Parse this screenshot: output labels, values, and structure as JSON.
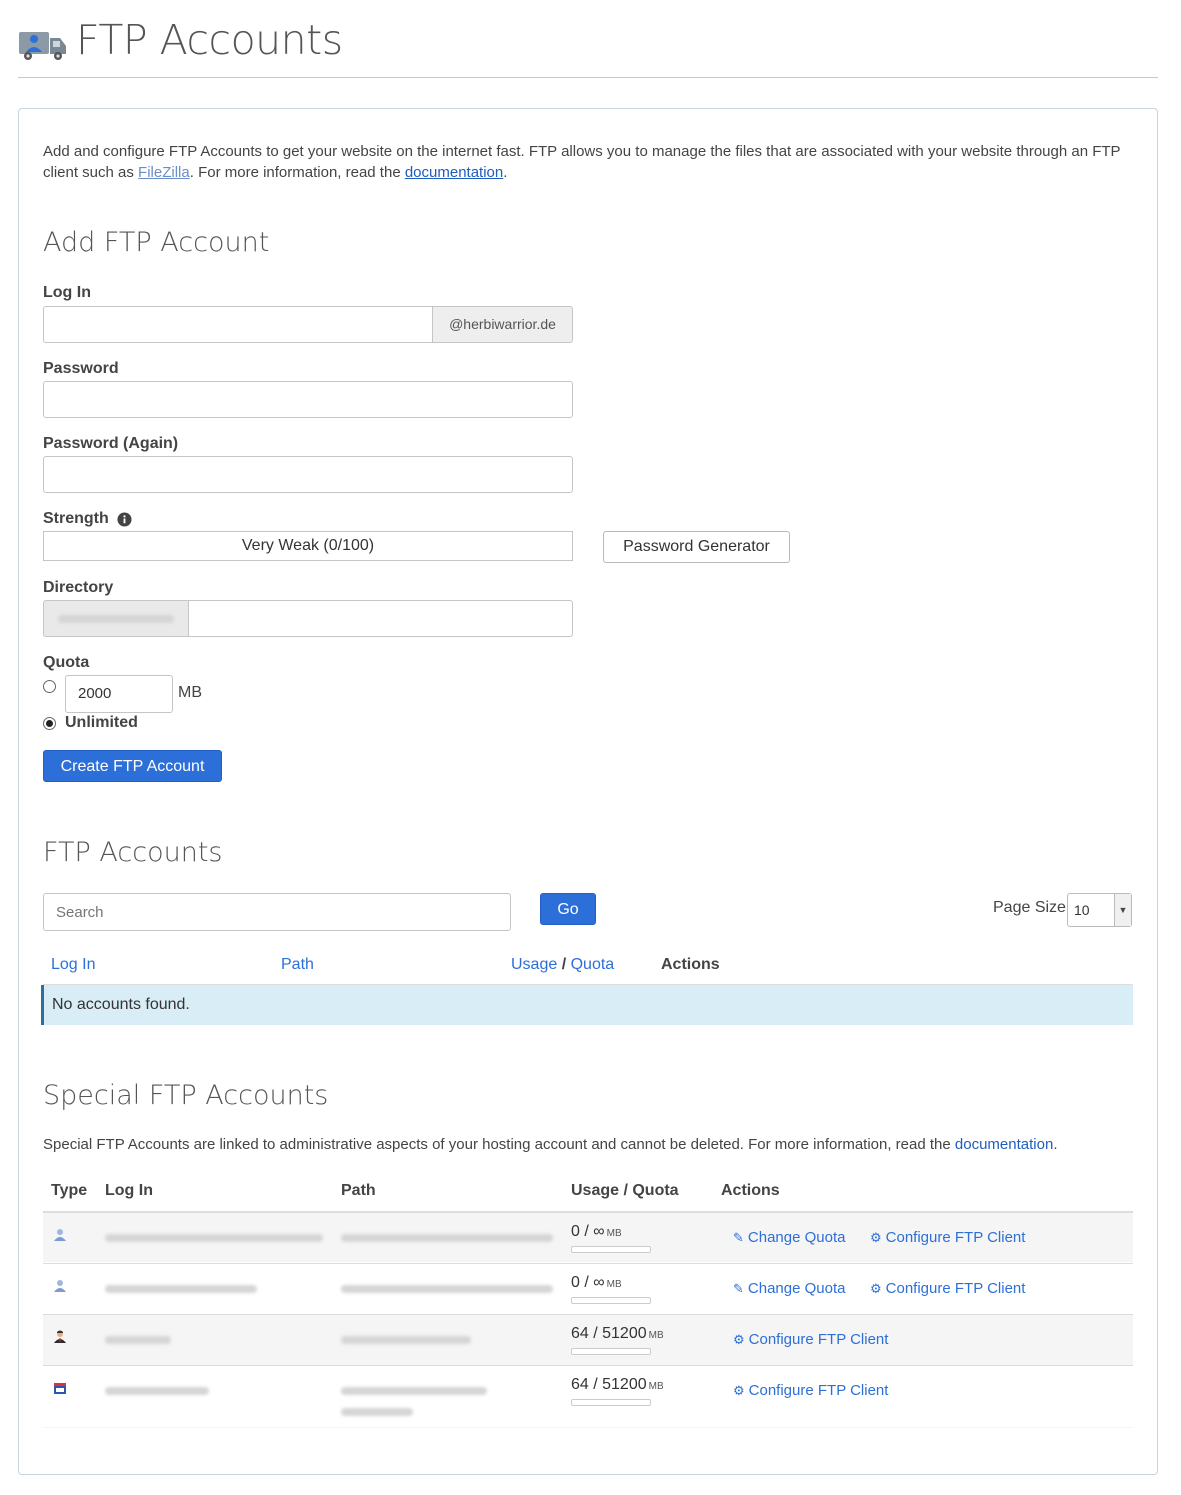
{
  "page": {
    "title": "FTP Accounts",
    "icon": "ftp-truck-icon"
  },
  "intro": {
    "text_before": "Add and configure FTP Accounts to get your website on the internet fast. FTP allows you to manage the files that are associated with your website through an FTP client such as ",
    "filezilla_link": "FileZilla",
    "text_middle": ". For more information, read the ",
    "doc_link": "documentation",
    "text_after": "."
  },
  "add_form": {
    "heading": "Add FTP Account",
    "login_label": "Log In",
    "login_value": "",
    "domain_suffix": "@herbiwarrior.de",
    "password_label": "Password",
    "password_again_label": "Password (Again)",
    "strength_label": "Strength",
    "strength_value": "Very Weak (0/100)",
    "password_generator": "Password Generator",
    "directory_label": "Directory",
    "directory_value": "",
    "quota_label": "Quota",
    "quota_value": "2000",
    "quota_unit": "MB",
    "unlimited_label": "Unlimited",
    "quota_selected": "Unlimited",
    "create_button": "Create FTP Account"
  },
  "accounts": {
    "heading": "FTP Accounts",
    "search_placeholder": "Search",
    "go_button": "Go",
    "page_size_label": "Page Size",
    "page_size_value": "10",
    "columns": {
      "login": "Log In",
      "path": "Path",
      "usage": "Usage",
      "slash": "/",
      "quota": "Quota",
      "actions": "Actions"
    },
    "empty_message": "No accounts found."
  },
  "special": {
    "heading": "Special FTP Accounts",
    "description": "Special FTP Accounts are linked to administrative aspects of your hosting account and cannot be deleted. For more information, read the ",
    "doc_link": "documentation",
    "description_end": ".",
    "columns": {
      "type": "Type",
      "login": "Log In",
      "path": "Path",
      "usage_quota": "Usage / Quota",
      "actions": "Actions"
    },
    "rows": [
      {
        "type_icon": "anonymous-user-icon",
        "usage": "0 / ∞",
        "unit": "MB",
        "usage_fraction": 0,
        "change_quota": "Change Quota",
        "configure": "Configure FTP Client"
      },
      {
        "type_icon": "anonymous-user-icon",
        "usage": "0 / ∞",
        "unit": "MB",
        "usage_fraction": 0,
        "change_quota": "Change Quota",
        "configure": "Configure FTP Client"
      },
      {
        "type_icon": "main-account-user-icon",
        "usage": "64 / 51200",
        "unit": "MB",
        "usage_fraction": 0.00125,
        "configure": "Configure FTP Client"
      },
      {
        "type_icon": "logs-calendar-icon",
        "usage": "64 / 51200",
        "unit": "MB",
        "usage_fraction": 0.00125,
        "configure": "Configure FTP Client"
      }
    ]
  },
  "colors": {
    "primary": "#2d6fd8",
    "link": "#1f5dbf",
    "info_bg": "#d9edf7"
  }
}
